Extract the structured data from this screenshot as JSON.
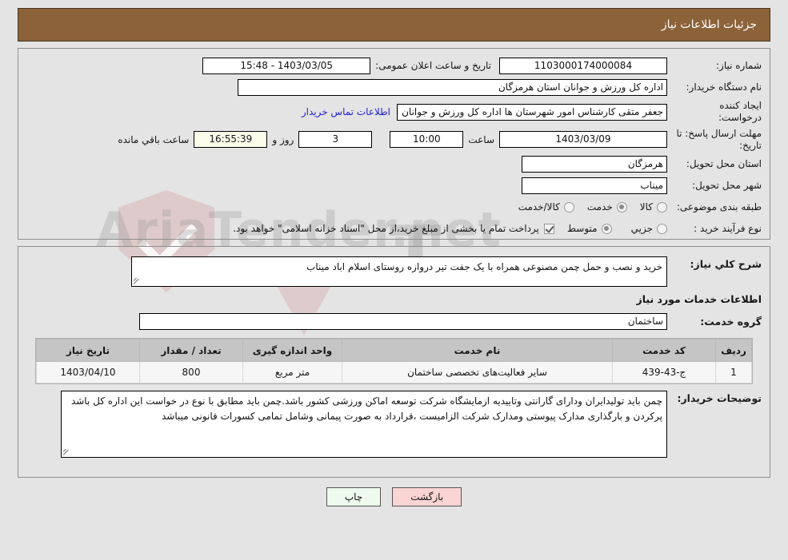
{
  "header": {
    "title": "جزئیات اطلاعات نیاز"
  },
  "info": {
    "need_number_label": "شماره نیاز:",
    "need_number_value": "1103000174000084",
    "public_announce_label": "تاریخ و ساعت اعلان عمومی:",
    "public_announce_value": "15:48 - 1403/03/05",
    "buyer_org_label": "نام دستگاه خریدار:",
    "buyer_org_value": "اداره کل ورزش و جوانان استان هرمزگان",
    "creator_label": "ایجاد کننده درخواست:",
    "creator_value": "جعفر متقی کارشناس امور شهرستان ها اداره کل ورزش و جوانان استان هرمزگان",
    "contact_link": "اطلاعات تماس خریدار",
    "deadline_label": "مهلت ارسال پاسخ: تا تاریخ:",
    "deadline_date": "1403/03/09",
    "hour_label": "ساعت",
    "deadline_time": "10:00",
    "days_value": "3",
    "days_label": "روز و",
    "countdown_value": "16:55:39",
    "countdown_label": "ساعت باقي مانده",
    "province_label": "استان محل تحویل:",
    "province_value": "هرمزگان",
    "city_label": "شهر محل تحویل:",
    "city_value": "میناب",
    "category_label": "طبقه بندی موضوعی:",
    "category_options": [
      {
        "label": "کالا",
        "selected": false
      },
      {
        "label": "خدمت",
        "selected": true
      },
      {
        "label": "کالا/خدمت",
        "selected": false
      }
    ],
    "process_label": "نوع فرآیند خرید :",
    "process_options": [
      {
        "label": "جزیي",
        "selected": false
      },
      {
        "label": "متوسط",
        "selected": true
      }
    ],
    "treasury_checkbox_checked": true,
    "treasury_text": "پرداخت تمام یا بخشی از مبلغ خرید،از محل \"اسناد خزانه اسلامی\" خواهد بود."
  },
  "details": {
    "need_desc_label": "شرح کلي نیاز:",
    "need_desc_value": "خرید و نصب و حمل چمن مصنوعی همراه با یک جفت تیر دروازه روستای اسلام اباد میناب",
    "services_section_title": "اطلاعات خدمات مورد نیاز",
    "service_group_label": "گروه خدمت:",
    "service_group_value": "ساختمان",
    "buyer_notes_label": "توضیحات خریدار:",
    "buyer_notes_value": "چمن باید تولیدایران ودارای گارانتی وتاییدیه ازمایشگاه شرکت توسعه اماکن ورزشی کشور باشد.چمن باید مطابق با نوع در خواست این اداره کل باشد پرکردن و بارگذاری مدارک پیوستی  ومدارک شرکت الزامیست ،قرارداد به صورت پیمانی وشامل تمامی کسورات قانونی میباشد"
  },
  "table": {
    "columns": [
      "ردیف",
      "کد خدمت",
      "نام خدمت",
      "واحد اندازه گیری",
      "تعداد / مقدار",
      "تاریخ نیاز"
    ],
    "rows": [
      {
        "radif": "1",
        "code": "ج-43-439",
        "name": "سایر فعالیت‌های تخصصی ساختمان",
        "unit": "متر مربع",
        "qty": "800",
        "date": "1403/04/10"
      }
    ]
  },
  "footer": {
    "print_label": "چاپ",
    "back_label": "بازگشت"
  },
  "watermark": {
    "text": "AriaTender.net",
    "t_glyph": "T"
  },
  "colors": {
    "header_bg": "#8c6239",
    "link": "#2222cc",
    "countdown_bg": "#fbfbea",
    "table_header_bg": "#c5c5c5",
    "print_btn_bg": "#eefaee",
    "back_btn_bg": "#fbd4d4"
  }
}
